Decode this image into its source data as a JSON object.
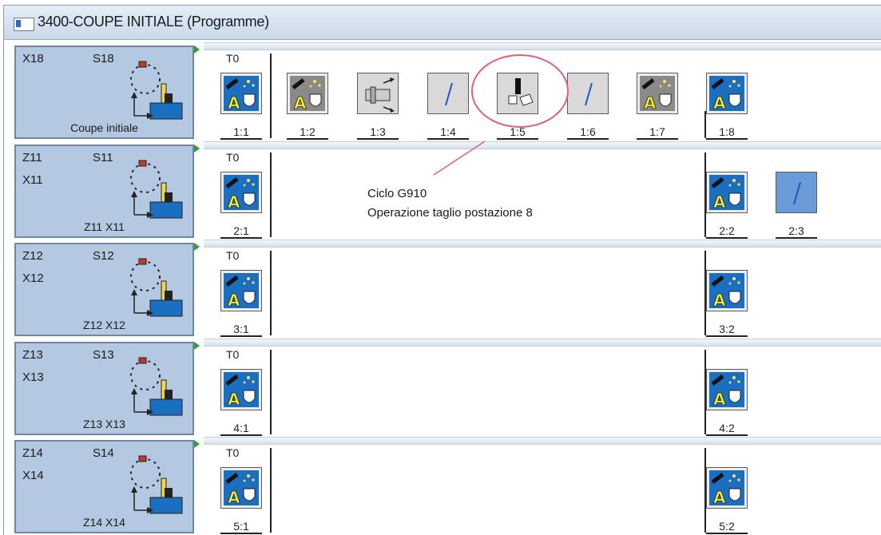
{
  "window": {
    "title": "3400-COUPE INITIALE (Programme)"
  },
  "channels": [
    {
      "axis1": "X18",
      "axis2": "",
      "spindle": "S18",
      "label": "Coupe initiale",
      "t0": "T0",
      "ops": [
        {
          "id": "1:1",
          "type": "tool"
        },
        {
          "id": "1:2",
          "type": "tool-gray"
        },
        {
          "id": "1:3",
          "type": "transfer"
        },
        {
          "id": "1:4",
          "type": "slash"
        },
        {
          "id": "1:5",
          "type": "cut"
        },
        {
          "id": "1:6",
          "type": "slash"
        },
        {
          "id": "1:7",
          "type": "tool-gray"
        },
        {
          "id": "1:8",
          "type": "tool"
        }
      ]
    },
    {
      "axis1": "Z11",
      "axis2": "X11",
      "spindle": "S11",
      "label": "Z11 X11",
      "t0": "T0",
      "ops": [
        {
          "id": "2:1",
          "type": "tool"
        },
        {
          "id": "2:2",
          "type": "tool"
        },
        {
          "id": "2:3",
          "type": "slash-blue"
        }
      ]
    },
    {
      "axis1": "Z12",
      "axis2": "X12",
      "spindle": "S12",
      "label": "Z12 X12",
      "t0": "T0",
      "ops": [
        {
          "id": "3:1",
          "type": "tool"
        },
        {
          "id": "3:2",
          "type": "tool"
        }
      ]
    },
    {
      "axis1": "Z13",
      "axis2": "X13",
      "spindle": "S13",
      "label": "Z13 X13",
      "t0": "T0",
      "ops": [
        {
          "id": "4:1",
          "type": "tool"
        },
        {
          "id": "4:2",
          "type": "tool"
        }
      ]
    },
    {
      "axis1": "Z14",
      "axis2": "X14",
      "spindle": "S14",
      "label": "Z14 X14",
      "t0": "T0",
      "ops": [
        {
          "id": "5:1",
          "type": "tool"
        },
        {
          "id": "5:2",
          "type": "tool"
        }
      ]
    }
  ],
  "annotation": {
    "line1": "Ciclo G910",
    "line2": "Operazione taglio postazione 8",
    "highlight_color": "#e0607a"
  },
  "colors": {
    "header_bg": "#b5c8e1",
    "tool_blue": "#1a6fc0",
    "slash_blue": "#6b9bd6"
  }
}
